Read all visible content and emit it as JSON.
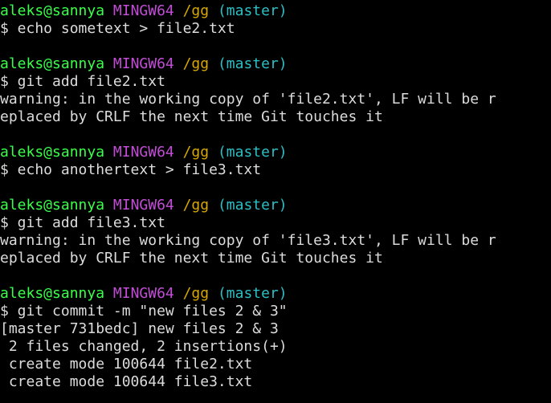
{
  "prompt": {
    "user": "aleks@sannya",
    "shell": "MINGW64",
    "path": "/gg",
    "branch": "(master)"
  },
  "lines": [
    {
      "type": "prompt"
    },
    {
      "type": "text",
      "text": "$ echo sometext > file2.txt"
    },
    {
      "type": "blank"
    },
    {
      "type": "prompt"
    },
    {
      "type": "text",
      "text": "$ git add file2.txt"
    },
    {
      "type": "text",
      "text": "warning: in the working copy of 'file2.txt', LF will be r"
    },
    {
      "type": "text",
      "text": "eplaced by CRLF the next time Git touches it"
    },
    {
      "type": "blank"
    },
    {
      "type": "prompt"
    },
    {
      "type": "text",
      "text": "$ echo anothertext > file3.txt"
    },
    {
      "type": "blank"
    },
    {
      "type": "prompt"
    },
    {
      "type": "text",
      "text": "$ git add file3.txt"
    },
    {
      "type": "text",
      "text": "warning: in the working copy of 'file3.txt', LF will be r"
    },
    {
      "type": "text",
      "text": "eplaced by CRLF the next time Git touches it"
    },
    {
      "type": "blank"
    },
    {
      "type": "prompt"
    },
    {
      "type": "text",
      "text": "$ git commit -m \"new files 2 & 3\""
    },
    {
      "type": "text",
      "text": "[master 731bedc] new files 2 & 3"
    },
    {
      "type": "text",
      "text": " 2 files changed, 2 insertions(+)"
    },
    {
      "type": "text",
      "text": " create mode 100644 file2.txt"
    },
    {
      "type": "text",
      "text": " create mode 100644 file3.txt"
    }
  ],
  "colors": {
    "background": "#000000",
    "text": "#dcdcdc",
    "user": "#39ff4a",
    "shell": "#c34dd8",
    "path": "#d6a800",
    "branch": "#2cbfc4"
  }
}
